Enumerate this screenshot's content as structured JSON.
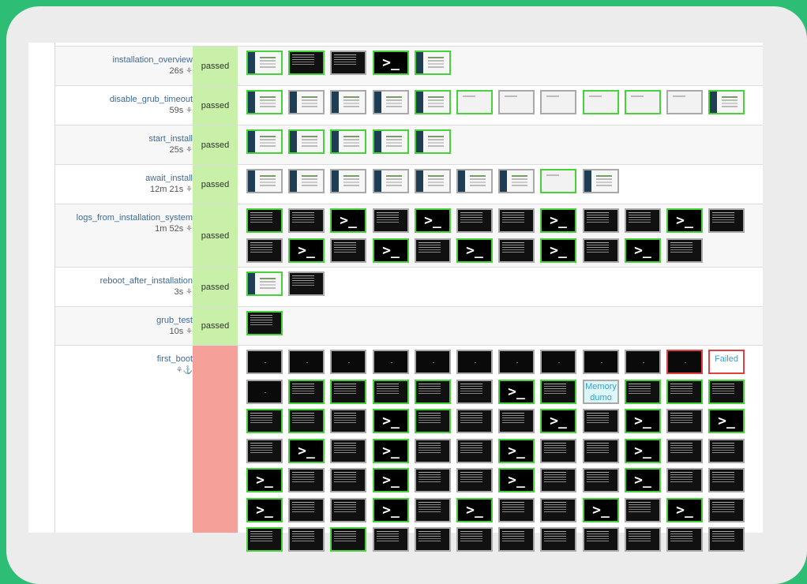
{
  "colors": {
    "pass_bg": "#c8f0a8",
    "fail_bg": "#f6a09a",
    "thumb_ok": "#47d13a",
    "thumb_neutral": "#a9a9a9",
    "thumb_fail": "#e04040",
    "link": "#3d6b9a",
    "frame": "#2ebd75"
  },
  "icons": {
    "time_suffix_icon": "bug-pin-icon",
    "anchor_icon": "anchor-icon",
    "terminal_icon": "terminal-prompt-icon"
  },
  "terminal_glyph": ">_",
  "rows": [
    {
      "name": "installation_overview",
      "time": "26s",
      "result": "passed",
      "status": "pass",
      "thumbs": [
        [
          "scr",
          "ok"
        ],
        [
          "txt",
          "ok"
        ],
        [
          "txt",
          "g"
        ],
        [
          "term",
          "ok"
        ],
        [
          "scr",
          "ok"
        ]
      ]
    },
    {
      "name": "disable_grub_timeout",
      "time": "59s",
      "result": "passed",
      "status": "pass",
      "thumbs": [
        [
          "scr",
          "ok"
        ],
        [
          "scr",
          "g"
        ],
        [
          "scr",
          "g"
        ],
        [
          "scr",
          "g"
        ],
        [
          "scr",
          "ok"
        ],
        [
          "lt",
          "ok"
        ],
        [
          "lt",
          "g"
        ],
        [
          "lt",
          "g"
        ],
        [
          "lt",
          "ok"
        ],
        [
          "lt",
          "ok"
        ],
        [
          "lt",
          "g"
        ],
        [
          "scr",
          "ok"
        ]
      ]
    },
    {
      "name": "start_install",
      "time": "25s",
      "result": "passed",
      "status": "pass",
      "thumbs": [
        [
          "scr",
          "ok"
        ],
        [
          "scr",
          "ok"
        ],
        [
          "scr",
          "ok"
        ],
        [
          "scr",
          "ok"
        ],
        [
          "scr",
          "ok"
        ]
      ]
    },
    {
      "name": "await_install",
      "time": "12m 21s",
      "result": "passed",
      "status": "pass",
      "thumbs": [
        [
          "scr",
          "g"
        ],
        [
          "scr",
          "g"
        ],
        [
          "scr",
          "g"
        ],
        [
          "scr",
          "g"
        ],
        [
          "scr",
          "g"
        ],
        [
          "scr",
          "g"
        ],
        [
          "scr",
          "g"
        ],
        [
          "lt",
          "ok"
        ],
        [
          "scr",
          "g"
        ]
      ]
    },
    {
      "name": "logs_from_installation_system",
      "time": "1m 52s",
      "result": "passed",
      "status": "pass",
      "thumbs": [
        [
          "txt",
          "ok"
        ],
        [
          "txt",
          "g"
        ],
        [
          "term",
          "ok"
        ],
        [
          "txt",
          "g"
        ],
        [
          "term",
          "ok"
        ],
        [
          "txt",
          "g"
        ],
        [
          "txt",
          "g"
        ],
        [
          "term",
          "ok"
        ],
        [
          "txt",
          "g"
        ],
        [
          "txt",
          "g"
        ],
        [
          "term",
          "ok"
        ],
        [
          "txt",
          "g"
        ],
        [
          "txt",
          "g"
        ],
        [
          "term",
          "ok"
        ],
        [
          "txt",
          "g"
        ],
        [
          "term",
          "ok"
        ],
        [
          "txt",
          "g"
        ],
        [
          "term",
          "ok"
        ],
        [
          "txt",
          "g"
        ],
        [
          "term",
          "ok"
        ],
        [
          "txt",
          "g"
        ],
        [
          "term",
          "ok"
        ],
        [
          "txt",
          "g"
        ]
      ]
    },
    {
      "name": "reboot_after_installation",
      "time": "3s",
      "result": "passed",
      "status": "pass",
      "thumbs": [
        [
          "scr",
          "ok"
        ],
        [
          "txt",
          "g"
        ]
      ]
    },
    {
      "name": "grub_test",
      "time": "10s",
      "result": "passed",
      "status": "pass",
      "thumbs": [
        [
          "txt",
          "ok"
        ]
      ]
    },
    {
      "name": "first_boot",
      "time": "",
      "result": "",
      "status": "fail",
      "thumbs": [
        [
          "dot",
          "g"
        ],
        [
          "dot",
          "g"
        ],
        [
          "dot",
          "g"
        ],
        [
          "dot",
          "g"
        ],
        [
          "dot",
          "g"
        ],
        [
          "dot",
          "g"
        ],
        [
          "dot",
          "g"
        ],
        [
          "dot",
          "g"
        ],
        [
          "dot",
          "g"
        ],
        [
          "dot",
          "g"
        ],
        [
          "dot",
          "r"
        ],
        [
          "failbox",
          "r"
        ],
        [
          "dot",
          "g"
        ],
        [
          "txt",
          "ok"
        ],
        [
          "txt",
          "ok"
        ],
        [
          "txt",
          "ok"
        ],
        [
          "txt",
          "ok"
        ],
        [
          "txt",
          "g"
        ],
        [
          "term",
          "ok"
        ],
        [
          "txt",
          "ok"
        ],
        [
          "note",
          "g"
        ],
        [
          "txt",
          "ok"
        ],
        [
          "txt",
          "ok"
        ],
        [
          "txt",
          "ok"
        ],
        [
          "txt",
          "ok"
        ],
        [
          "txt",
          "ok"
        ],
        [
          "txt",
          "g"
        ],
        [
          "term",
          "ok"
        ],
        [
          "txt",
          "ok"
        ],
        [
          "txt",
          "g"
        ],
        [
          "txt",
          "g"
        ],
        [
          "term",
          "ok"
        ],
        [
          "txt",
          "g"
        ],
        [
          "term",
          "ok"
        ],
        [
          "txt",
          "g"
        ],
        [
          "term",
          "ok"
        ],
        [
          "txt",
          "g"
        ],
        [
          "term",
          "ok"
        ],
        [
          "txt",
          "g"
        ],
        [
          "term",
          "ok"
        ],
        [
          "txt",
          "g"
        ],
        [
          "txt",
          "g"
        ],
        [
          "term",
          "ok"
        ],
        [
          "txt",
          "g"
        ],
        [
          "txt",
          "g"
        ],
        [
          "term",
          "ok"
        ],
        [
          "txt",
          "g"
        ],
        [
          "txt",
          "g"
        ],
        [
          "term",
          "ok"
        ],
        [
          "txt",
          "g"
        ],
        [
          "txt",
          "g"
        ],
        [
          "term",
          "ok"
        ],
        [
          "txt",
          "g"
        ],
        [
          "txt",
          "g"
        ],
        [
          "term",
          "ok"
        ],
        [
          "txt",
          "g"
        ],
        [
          "txt",
          "g"
        ],
        [
          "term",
          "ok"
        ],
        [
          "txt",
          "g"
        ],
        [
          "txt",
          "g"
        ],
        [
          "term",
          "ok"
        ],
        [
          "txt",
          "g"
        ],
        [
          "txt",
          "g"
        ],
        [
          "term",
          "ok"
        ],
        [
          "txt",
          "g"
        ],
        [
          "term",
          "ok"
        ],
        [
          "txt",
          "g"
        ],
        [
          "txt",
          "g"
        ],
        [
          "term",
          "ok"
        ],
        [
          "txt",
          "g"
        ],
        [
          "term",
          "ok"
        ],
        [
          "txt",
          "g"
        ],
        [
          "txt",
          "ok"
        ],
        [
          "txt",
          "g"
        ],
        [
          "txt",
          "ok"
        ],
        [
          "txt",
          "g"
        ],
        [
          "txt",
          "g"
        ],
        [
          "txt",
          "g"
        ],
        [
          "txt",
          "g"
        ],
        [
          "txt",
          "g"
        ],
        [
          "txt",
          "g"
        ],
        [
          "txt",
          "g"
        ],
        [
          "txt",
          "g"
        ],
        [
          "txt",
          "g"
        ]
      ]
    }
  ],
  "notes": {
    "memory_dump": "Memory dumo",
    "failed": "Failed"
  }
}
